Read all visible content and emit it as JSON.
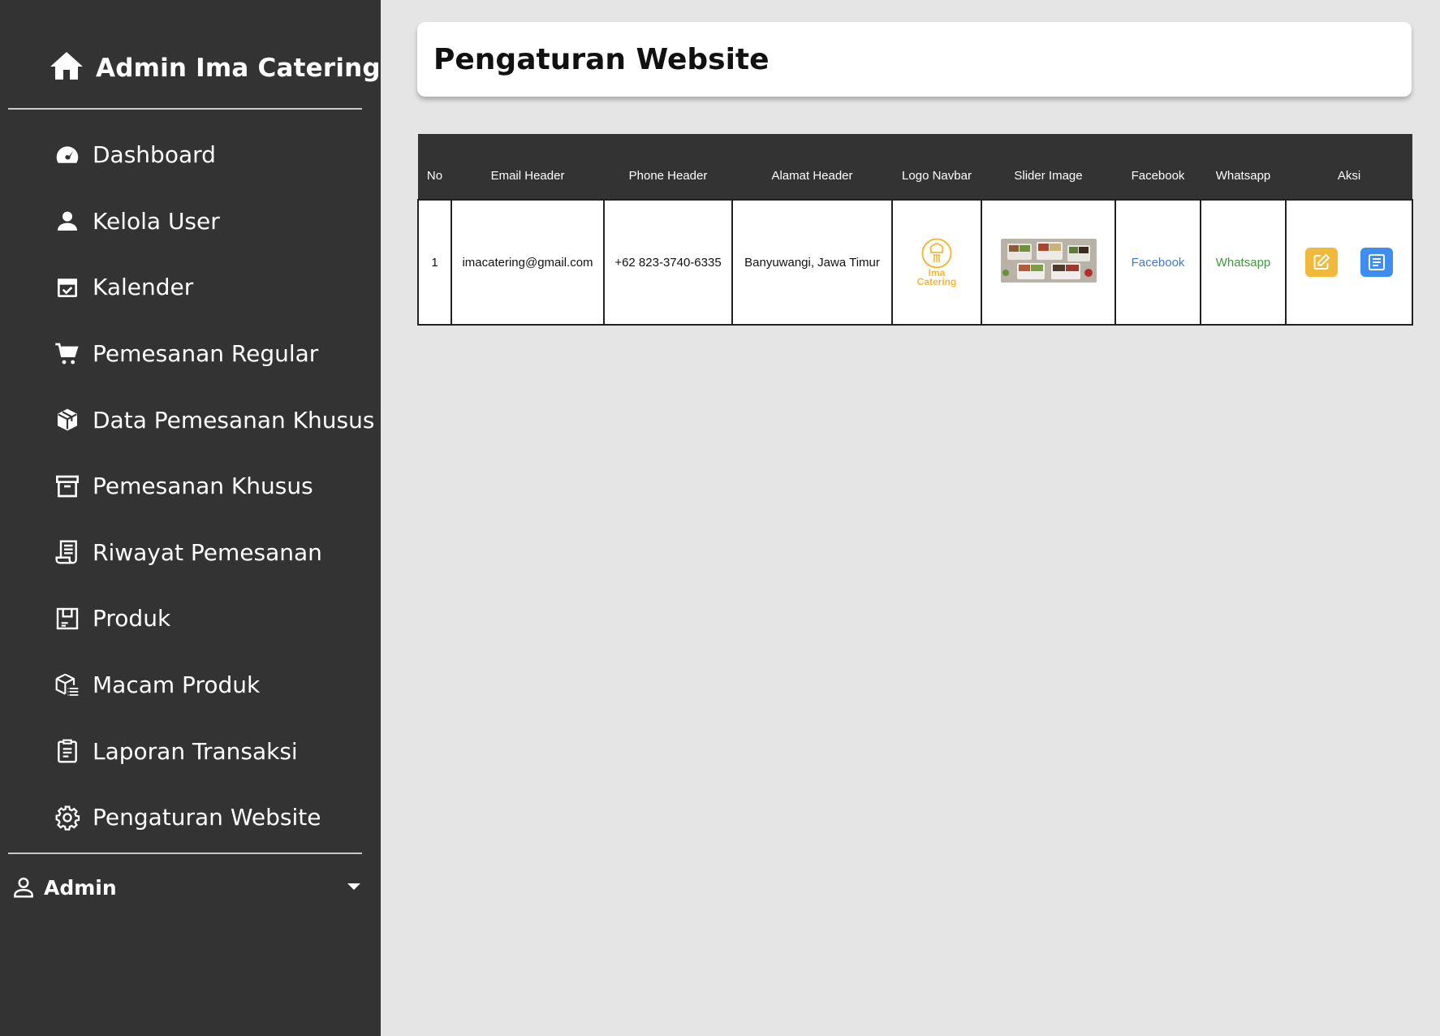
{
  "app": {
    "title": "Admin Ima Catering"
  },
  "sidebar": {
    "items": [
      {
        "label": "Dashboard",
        "icon": "dashboard-gauge-icon"
      },
      {
        "label": "Kelola User",
        "icon": "user-icon"
      },
      {
        "label": "Kalender",
        "icon": "calendar-check-icon"
      },
      {
        "label": "Pemesanan Regular",
        "icon": "cart-icon"
      },
      {
        "label": "Data Pemesanan Khusus",
        "icon": "box-icon"
      },
      {
        "label": "Pemesanan Khusus",
        "icon": "archive-icon"
      },
      {
        "label": "Riwayat Pemesanan",
        "icon": "receipt-icon"
      },
      {
        "label": "Produk",
        "icon": "product-icon"
      },
      {
        "label": "Macam Produk",
        "icon": "box-list-icon"
      },
      {
        "label": "Laporan Transaksi",
        "icon": "report-icon"
      },
      {
        "label": "Pengaturan Website",
        "icon": "gear-icon"
      }
    ],
    "user": {
      "name": "Admin",
      "icon": "user-outline-icon"
    }
  },
  "main": {
    "title": "Pengaturan Website"
  },
  "table": {
    "headers": [
      "No",
      "Email Header",
      "Phone Header",
      "Alamat Header",
      "Logo Navbar",
      "Slider Image",
      "Facebook",
      "Whatsapp",
      "Aksi"
    ],
    "rows": [
      {
        "no": "1",
        "email": "imacatering@gmail.com",
        "phone": "+62 823-3740-6335",
        "alamat": "Banyuwangi, Jawa Timur",
        "logo_text_1": "Ima",
        "logo_text_2": "Catering",
        "facebook": "Facebook",
        "whatsapp": "Whatsapp"
      }
    ]
  },
  "colors": {
    "sidebar_bg": "#333333",
    "content_bg": "#e5e5e5",
    "edit_button": "#f0b93a",
    "detail_button": "#3d8ef0",
    "facebook_link": "#3a7bd5",
    "whatsapp_link": "#3b9a3b"
  }
}
